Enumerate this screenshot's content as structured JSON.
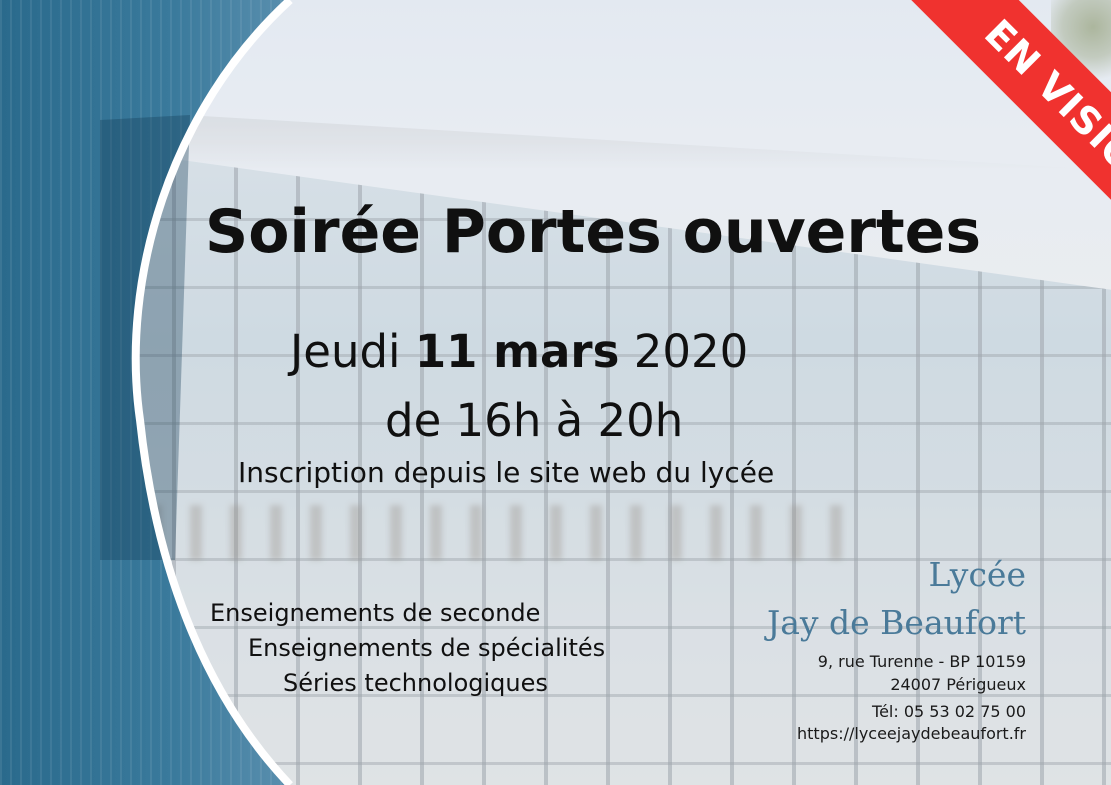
{
  "ribbon": {
    "label": "EN VISIO",
    "color": "#f0322f"
  },
  "title": "Soirée Portes ouvertes",
  "date": {
    "prefix": "Jeudi ",
    "bold": "11 mars",
    "suffix": " 2020"
  },
  "hours": "de 16h à 20h",
  "inscription": "Inscription depuis le site web du lycée",
  "offers": [
    "Enseignements de seconde",
    "Enseignements de spécialités",
    "Séries technologiques"
  ],
  "school": {
    "line1": "Lycée",
    "line2": "Jay de Beaufort",
    "color": "#4a7a99"
  },
  "address": {
    "street": "9, rue Turenne - BP 10159",
    "city": "24007 Périgueux",
    "phone": "Tél: 05 53 02 75 00",
    "website": "https://lyceejaydebeaufort.fr"
  },
  "colors": {
    "arc_outer": "#1f5f82",
    "arc_inner": "#5d93b2"
  }
}
